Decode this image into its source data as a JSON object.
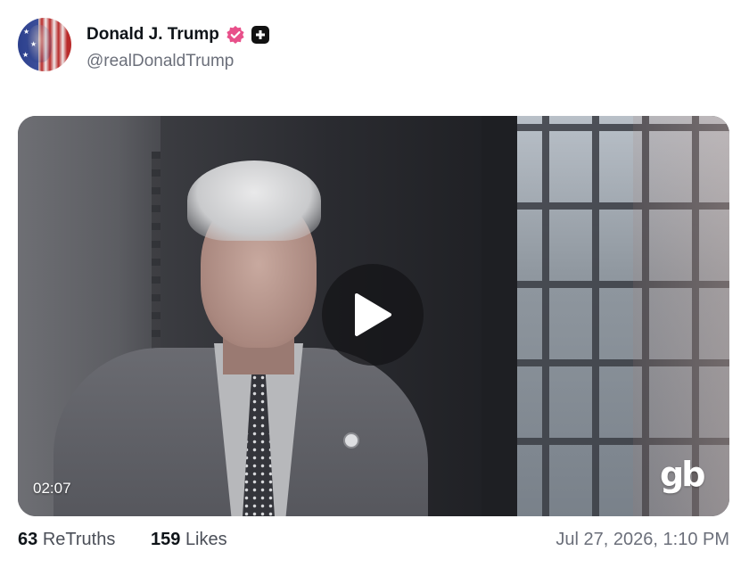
{
  "post": {
    "author": {
      "display_name": "Donald J. Trump",
      "handle": "@realDonaldTrump",
      "avatar_icon": "flag-portrait-avatar",
      "verified_icon": "verified-badge-icon",
      "verified_color": "#e8508a",
      "extra_badge_icon": "plus-badge-icon"
    },
    "video": {
      "duration": "02:07",
      "watermark": "gb",
      "play_icon": "play-icon"
    },
    "stats": {
      "retruths_count": "63",
      "retruths_label": "ReTruths",
      "likes_count": "159",
      "likes_label": "Likes"
    },
    "timestamp": "Jul 27, 2026, 1:10 PM"
  }
}
